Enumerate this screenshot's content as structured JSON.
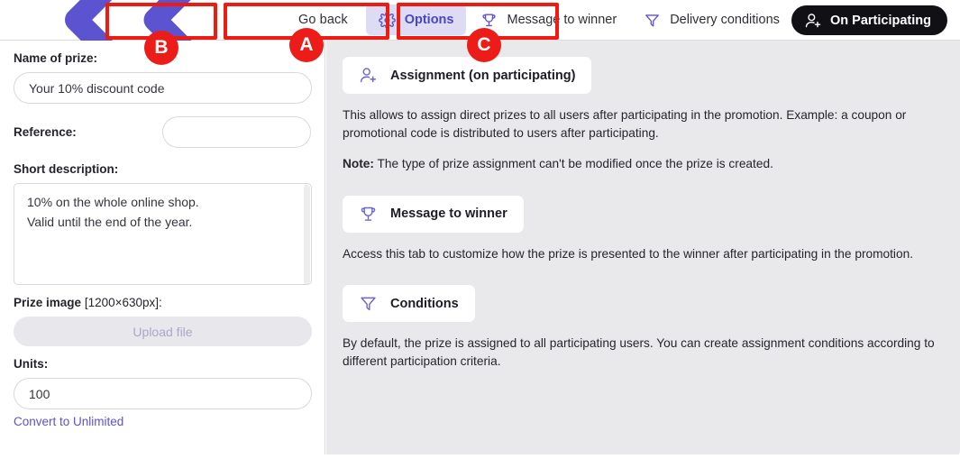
{
  "header": {
    "go_back": "Go back",
    "go_back_icon": "chevrons-left-icon",
    "tabs": [
      {
        "label": "Options",
        "icon": "gear-icon",
        "active": true
      },
      {
        "label": "Message to winner",
        "icon": "trophy-icon",
        "active": false
      },
      {
        "label": "Delivery conditions",
        "icon": "funnel-icon",
        "active": false
      }
    ],
    "status": {
      "label": "On Participating",
      "icon": "user-add-icon"
    }
  },
  "sidebar": {
    "name_label": "Name of prize:",
    "name_value": "Your 10% discount code",
    "reference_label": "Reference:",
    "reference_value": "",
    "description_label": "Short description:",
    "description_value": "10% on the whole online shop.\nValid until the end of the year.",
    "prize_image_label": "Prize image",
    "prize_image_dim": "[1200×630px]:",
    "upload_label": "Upload file",
    "units_label": "Units:",
    "units_value": "100",
    "convert_link": "Convert to Unlimited"
  },
  "content": {
    "blocks": [
      {
        "button": "Assignment (on participating)",
        "icon": "user-add-icon",
        "body": "This allows to assign direct prizes to all users after participating in the promotion. Example: a coupon or promotional code is distributed to users after participating.",
        "note_label": "Note:",
        "note_body": " The type of prize assignment can't be modified once the prize is created."
      },
      {
        "button": "Message to winner",
        "icon": "trophy-icon",
        "body": "Access this tab to customize how the prize is presented to the winner after participating in the promotion.",
        "note_label": "",
        "note_body": ""
      },
      {
        "button": "Conditions",
        "icon": "funnel-icon",
        "body": "By default, the prize is assigned to all participating users. You can create assignment conditions according to different participation criteria.",
        "note_label": "",
        "note_body": ""
      }
    ]
  },
  "annotations": {
    "markers": [
      {
        "label": "A",
        "target": "tab-message-to-winner"
      },
      {
        "label": "B",
        "target": "tab-options"
      },
      {
        "label": "C",
        "target": "tab-delivery-conditions"
      }
    ]
  },
  "colors": {
    "accent": "#5b53cf",
    "accent_bg": "#dedcf5",
    "annotation": "#ec1c18",
    "panel_bg": "#e9e9ec",
    "status_bg": "#111115"
  }
}
